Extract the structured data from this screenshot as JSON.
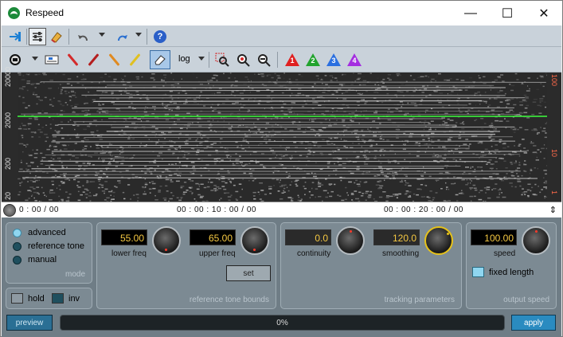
{
  "window": {
    "title": "Respeed",
    "minimize_glyph": "—",
    "maximize_glyph": "☐",
    "close_glyph": "✕"
  },
  "toolbar1": {
    "items": [
      "pin-icon",
      "settings-icon",
      "clear-icon",
      "undo-icon",
      "redo-icon",
      "help-icon"
    ]
  },
  "toolbar2": {
    "scale_value": "log",
    "markers": [
      {
        "label": "1",
        "color": "#e02020"
      },
      {
        "label": "2",
        "color": "#21a32e"
      },
      {
        "label": "3",
        "color": "#2a6fe0"
      },
      {
        "label": "4",
        "color": "#a42ee0"
      }
    ],
    "pen_colors": [
      "#d42a2a",
      "#c42a2a",
      "#e07a20",
      "#e0c020"
    ]
  },
  "spectrogram": {
    "y_axis_left": [
      "20000",
      "2000",
      "200",
      "20"
    ],
    "y_axis_right": [
      "100",
      "10",
      "1"
    ],
    "time_labels": [
      "0 : 00 / 00",
      "00 : 00 : 10 : 00 / 00",
      "00 : 00 : 20 : 00 / 00"
    ],
    "reference_line_color": "#3cff3c"
  },
  "mode": {
    "options": [
      {
        "label": "advanced",
        "selected": true
      },
      {
        "label": "reference tone",
        "selected": false
      },
      {
        "label": "manual",
        "selected": false
      }
    ],
    "title": "mode"
  },
  "options": {
    "hold_label": "hold",
    "inv_label": "inv",
    "hold_checked": false,
    "inv_checked": true
  },
  "reference_tone_bounds": {
    "lower_freq_value": "55.00",
    "lower_freq_label": "lower freq",
    "upper_freq_value": "65.00",
    "upper_freq_label": "upper freq",
    "set_label": "set",
    "title": "reference tone bounds"
  },
  "tracking_parameters": {
    "continuity_value": "0.0",
    "continuity_label": "continuity",
    "smoothing_value": "120.0",
    "smoothing_label": "smoothing",
    "title": "tracking parameters"
  },
  "output_speed": {
    "speed_value": "100.00",
    "speed_label": "speed",
    "fixed_length_label": "fixed length",
    "fixed_length_checked": true,
    "title": "output speed"
  },
  "footer": {
    "preview_label": "preview",
    "progress_text": "0%",
    "apply_label": "apply"
  }
}
